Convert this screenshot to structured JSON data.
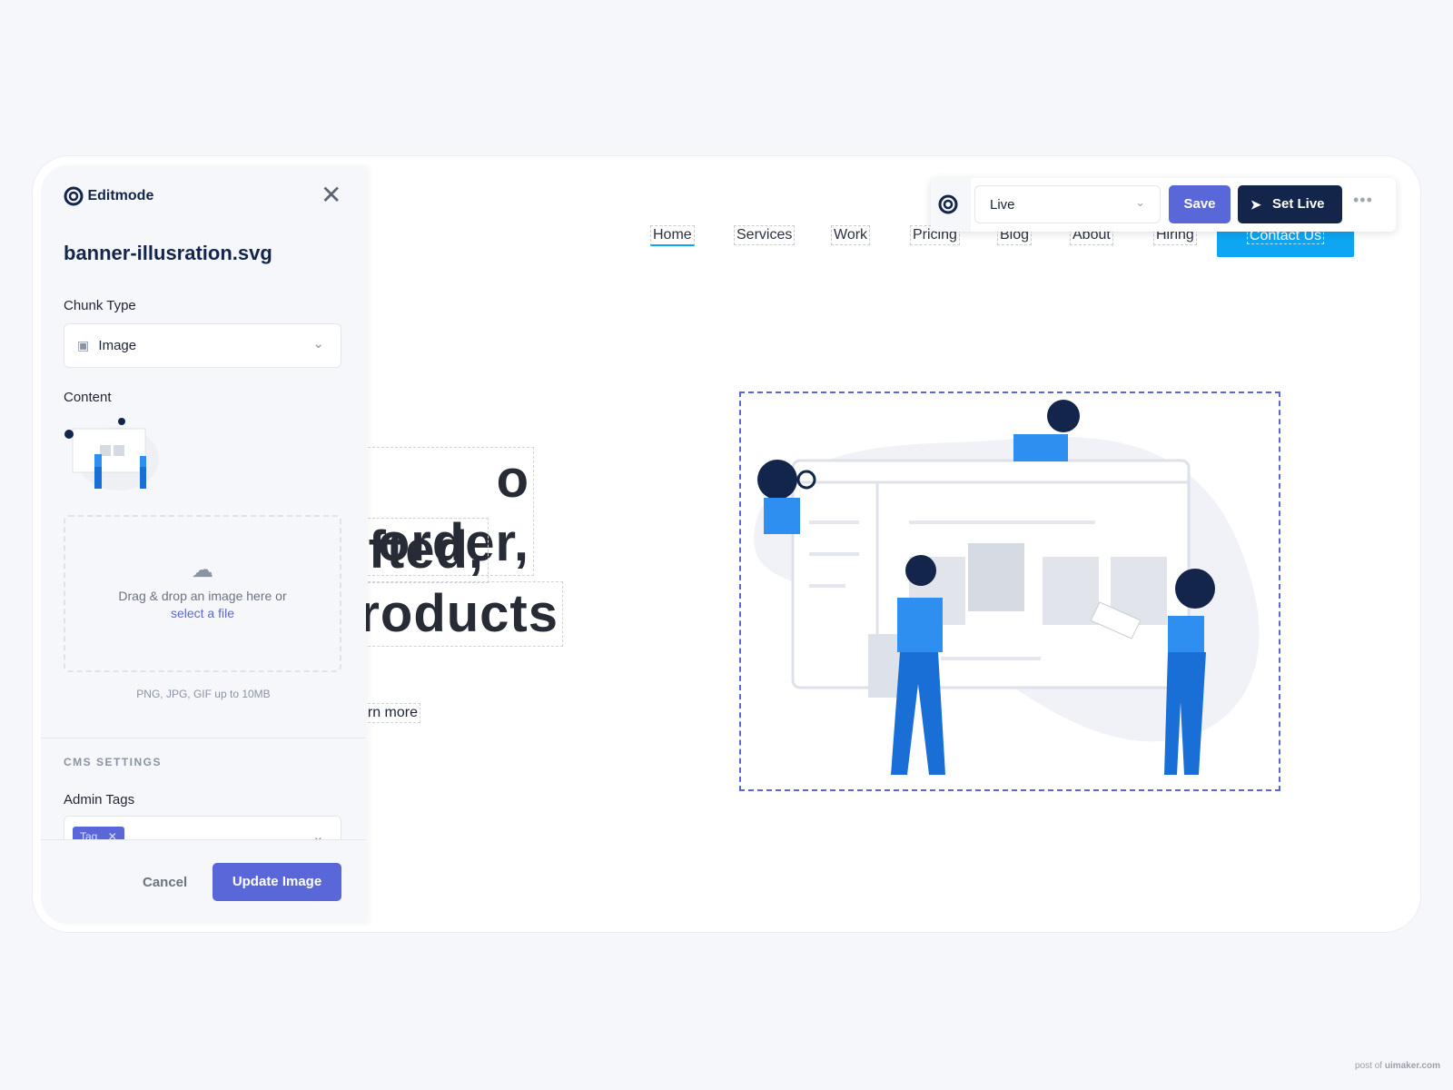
{
  "site_nav": {
    "items": [
      "Home",
      "Services",
      "Work",
      "Pricing",
      "Blog",
      "About",
      "Hiring"
    ],
    "active": "Home",
    "cta": "Contact Us"
  },
  "hero": {
    "lines": [
      "o order,",
      "fted,",
      "roducts"
    ],
    "link": "rn more"
  },
  "toolbar": {
    "status": "Live",
    "save": "Save",
    "set_live": "Set Live",
    "more_icon": "ellipsis-icon"
  },
  "panel": {
    "brand": "Editmode",
    "title": "banner-illusration.svg",
    "chunk_type_label": "Chunk Type",
    "chunk_type_value": "Image",
    "content_label": "Content",
    "dropzone_text": "Drag & drop an image here or",
    "dropzone_link": "select a file",
    "hint": "PNG, JPG, GIF up to 10MB",
    "cms_heading": "CMS SETTINGS",
    "admin_tags_label": "Admin Tags",
    "tags": [
      "Tag"
    ],
    "cancel": "Cancel",
    "update": "Update Image"
  },
  "colors": {
    "accent": "#5a67d8",
    "navy": "#13254b",
    "cta": "#0ea5f3",
    "figure_blue": "#2f8ff0"
  },
  "footer": {
    "credit_prefix": "post of",
    "credit_site": "uimaker.com"
  }
}
